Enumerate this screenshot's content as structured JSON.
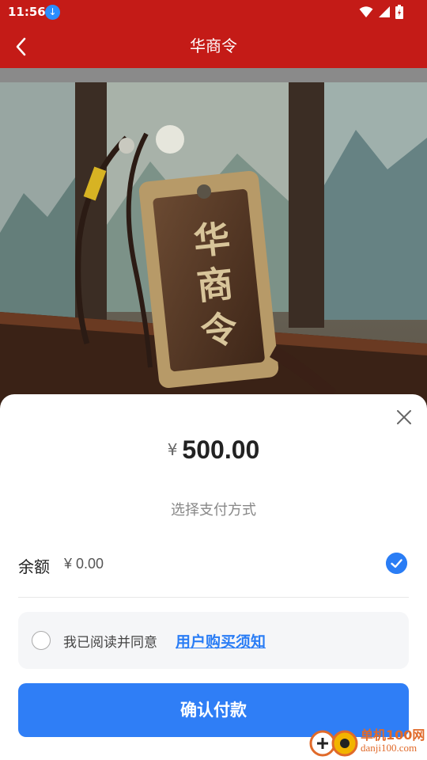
{
  "status_bar": {
    "time": "11:56",
    "icons": [
      "download-icon",
      "wifi-icon",
      "signal-icon",
      "battery-icon"
    ]
  },
  "app_bar": {
    "title": "华商令",
    "back_icon": "chevron-left-icon",
    "background_color": "#c41b17"
  },
  "hero": {
    "pendant_text": [
      "华",
      "商",
      "令"
    ]
  },
  "payment_sheet": {
    "close_icon": "close-icon",
    "currency_symbol": "¥",
    "amount": "500.00",
    "choose_method_label": "选择支付方式",
    "balance": {
      "label": "余额",
      "value": "¥ 0.00",
      "selected": true
    },
    "agreement": {
      "checked": false,
      "text": "我已阅读并同意",
      "link_text": "用户购买须知"
    },
    "confirm_button": "确认付款",
    "accent_color": "#2f7ef6"
  },
  "watermark": {
    "brand": "单机100网",
    "url": "danji100.com"
  }
}
